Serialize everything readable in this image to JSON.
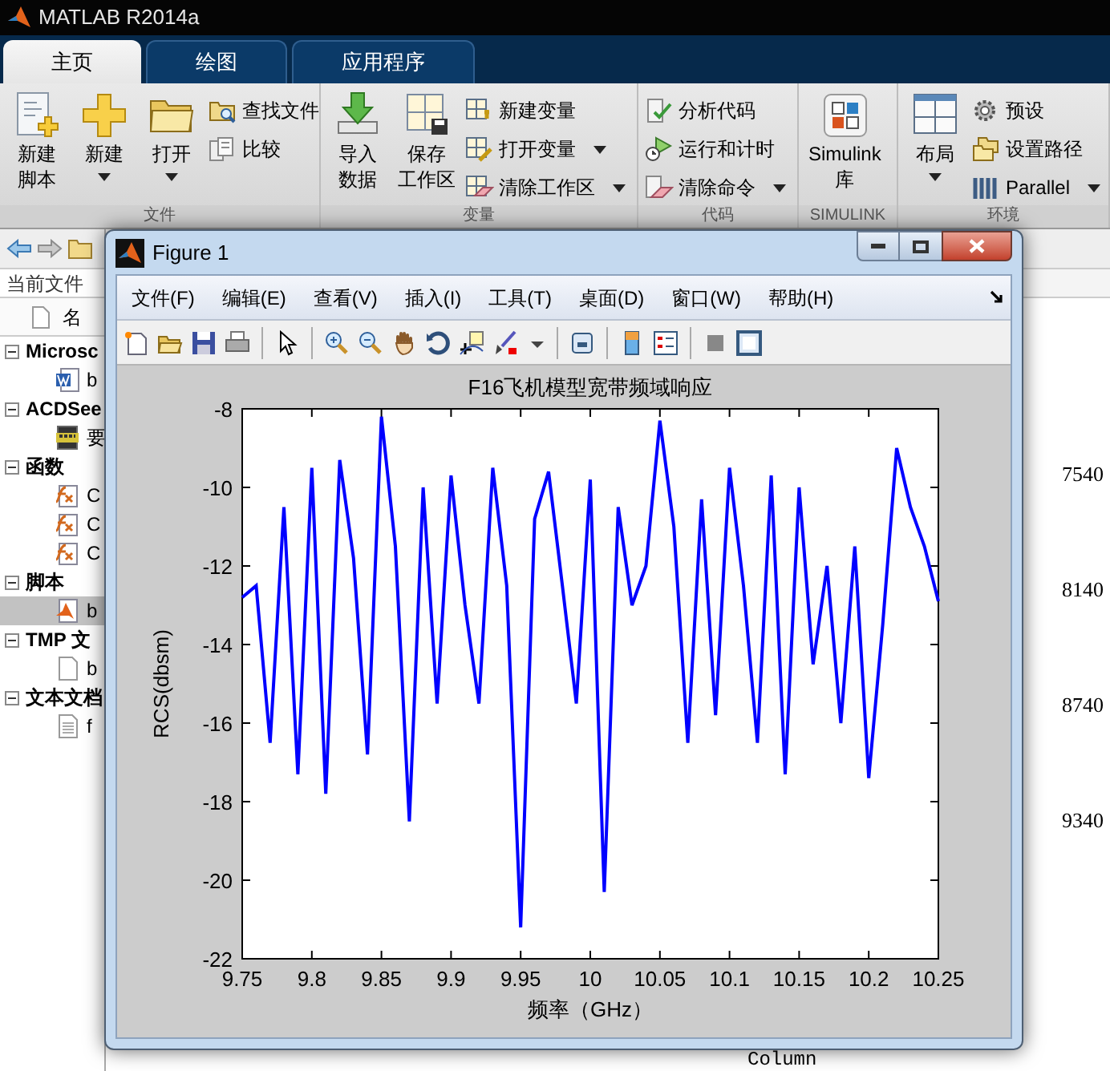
{
  "window": {
    "title": "MATLAB R2014a"
  },
  "tabs": [
    {
      "label": "主页",
      "selected": true
    },
    {
      "label": "绘图",
      "selected": false
    },
    {
      "label": "应用程序",
      "selected": false
    }
  ],
  "ribbon": {
    "groups": [
      {
        "label": "文件",
        "items": [
          {
            "kind": "large",
            "lines": [
              "新建",
              "脚本"
            ],
            "dropdown": false
          },
          {
            "kind": "large",
            "lines": [
              "新建"
            ],
            "dropdown": true
          },
          {
            "kind": "large",
            "lines": [
              "打开"
            ],
            "dropdown": true
          },
          {
            "kind": "stack",
            "items": [
              {
                "label": "查找文件",
                "dropdown": false
              },
              {
                "label": "比较",
                "dropdown": false
              }
            ]
          }
        ]
      },
      {
        "label": "变量",
        "items": [
          {
            "kind": "large",
            "lines": [
              "导入",
              "数据"
            ],
            "dropdown": false
          },
          {
            "kind": "large",
            "lines": [
              "保存",
              "工作区"
            ],
            "dropdown": false
          },
          {
            "kind": "stack",
            "items": [
              {
                "label": "新建变量",
                "dropdown": false
              },
              {
                "label": "打开变量",
                "dropdown": true
              },
              {
                "label": "清除工作区",
                "dropdown": true
              }
            ]
          }
        ]
      },
      {
        "label": "代码",
        "items": [
          {
            "kind": "stack",
            "items": [
              {
                "label": "分析代码",
                "dropdown": false
              },
              {
                "label": "运行和计时",
                "dropdown": false
              },
              {
                "label": "清除命令",
                "dropdown": true
              }
            ]
          }
        ]
      },
      {
        "label": "SIMULINK",
        "items": [
          {
            "kind": "large",
            "lines": [
              "Simulink",
              "库"
            ],
            "dropdown": false
          }
        ]
      },
      {
        "label": "环境",
        "items": [
          {
            "kind": "large",
            "lines": [
              "布局"
            ],
            "dropdown": true
          },
          {
            "kind": "stack",
            "items": [
              {
                "label": "预设",
                "dropdown": false
              },
              {
                "label": "设置路径",
                "dropdown": false
              },
              {
                "label": "Parallel",
                "dropdown": true
              }
            ]
          }
        ]
      }
    ]
  },
  "file_browser": {
    "header": "当前文件",
    "column": "名",
    "groups": [
      {
        "label": "Microsc",
        "expanded": true,
        "children": [
          {
            "kind": "word",
            "label": "b",
            "selected": false
          }
        ]
      },
      {
        "label": "ACDSee",
        "expanded": true,
        "children": [
          {
            "kind": "image",
            "label": "要",
            "selected": false
          }
        ]
      },
      {
        "label": "函数",
        "expanded": true,
        "children": [
          {
            "kind": "function",
            "label": "C",
            "selected": false
          },
          {
            "kind": "function",
            "label": "C",
            "selected": false
          },
          {
            "kind": "function",
            "label": "C",
            "selected": false
          }
        ]
      },
      {
        "label": "脚本",
        "expanded": true,
        "children": [
          {
            "kind": "script",
            "label": "b",
            "selected": true
          }
        ]
      },
      {
        "label": "TMP 文",
        "expanded": true,
        "children": [
          {
            "kind": "file",
            "label": "b",
            "selected": false
          }
        ]
      },
      {
        "label": "文本文档",
        "expanded": true,
        "children": [
          {
            "kind": "text",
            "label": "f",
            "selected": false
          }
        ]
      }
    ]
  },
  "command_window": {
    "lines": [
      "7540",
      "8140",
      "8740",
      "9340"
    ],
    "footer": "Column"
  },
  "figure": {
    "title": "Figure 1",
    "menus": [
      "文件(F)",
      "编辑(E)",
      "查看(V)",
      "插入(I)",
      "工具(T)",
      "桌面(D)",
      "窗口(W)",
      "帮助(H)"
    ],
    "chart_data": {
      "type": "line",
      "title": "F16飞机模型宽带频域响应",
      "xlabel": "频率（GHz）",
      "ylabel": "RCS(dbsm)",
      "xlim": [
        9.75,
        10.25
      ],
      "ylim": [
        -22,
        -8
      ],
      "xticks": [
        9.75,
        9.8,
        9.85,
        9.9,
        9.95,
        10,
        10.05,
        10.1,
        10.15,
        10.2,
        10.25
      ],
      "yticks": [
        -22,
        -20,
        -18,
        -16,
        -14,
        -12,
        -10,
        -8
      ],
      "x": [
        9.75,
        9.76,
        9.77,
        9.78,
        9.79,
        9.8,
        9.81,
        9.82,
        9.83,
        9.84,
        9.85,
        9.86,
        9.87,
        9.88,
        9.89,
        9.9,
        9.91,
        9.92,
        9.93,
        9.94,
        9.95,
        9.96,
        9.97,
        9.98,
        9.99,
        10,
        10.01,
        10.02,
        10.03,
        10.04,
        10.05,
        10.06,
        10.07,
        10.08,
        10.09,
        10.1,
        10.11,
        10.12,
        10.13,
        10.14,
        10.15,
        10.16,
        10.17,
        10.18,
        10.19,
        10.2,
        10.21,
        10.22,
        10.23,
        10.24,
        10.25
      ],
      "series": [
        {
          "color": "#0000ff",
          "values": [
            -12.8,
            -12.5,
            -16.5,
            -10.5,
            -17.3,
            -9.5,
            -17.8,
            -9.3,
            -11.8,
            -16.8,
            -8.2,
            -11.5,
            -18.5,
            -10,
            -15.5,
            -9.7,
            -13,
            -15.5,
            -9.5,
            -12.5,
            -21.2,
            -10.8,
            -9.6,
            -12.5,
            -15.5,
            -9.8,
            -20.3,
            -10.5,
            -13,
            -12,
            -8.3,
            -11,
            -16.5,
            -10.3,
            -15.8,
            -9.5,
            -12.5,
            -16.5,
            -9.7,
            -17.3,
            -10,
            -14.5,
            -12,
            -16,
            -11.5,
            -17.4,
            -13.5,
            -9,
            -10.5,
            -11.5,
            -12.9
          ]
        }
      ]
    }
  }
}
